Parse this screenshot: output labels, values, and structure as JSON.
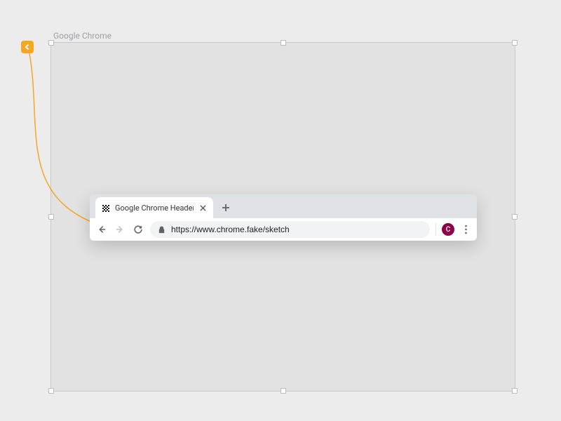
{
  "frame": {
    "label": "Google Chrome"
  },
  "chrome": {
    "tab": {
      "title": "Google Chrome Header UI Freebie",
      "favicon": "checker-pattern-icon"
    },
    "url": "https://www.chrome.fake/sketch",
    "profile": {
      "initial": "C",
      "color": "#8b0046"
    }
  }
}
